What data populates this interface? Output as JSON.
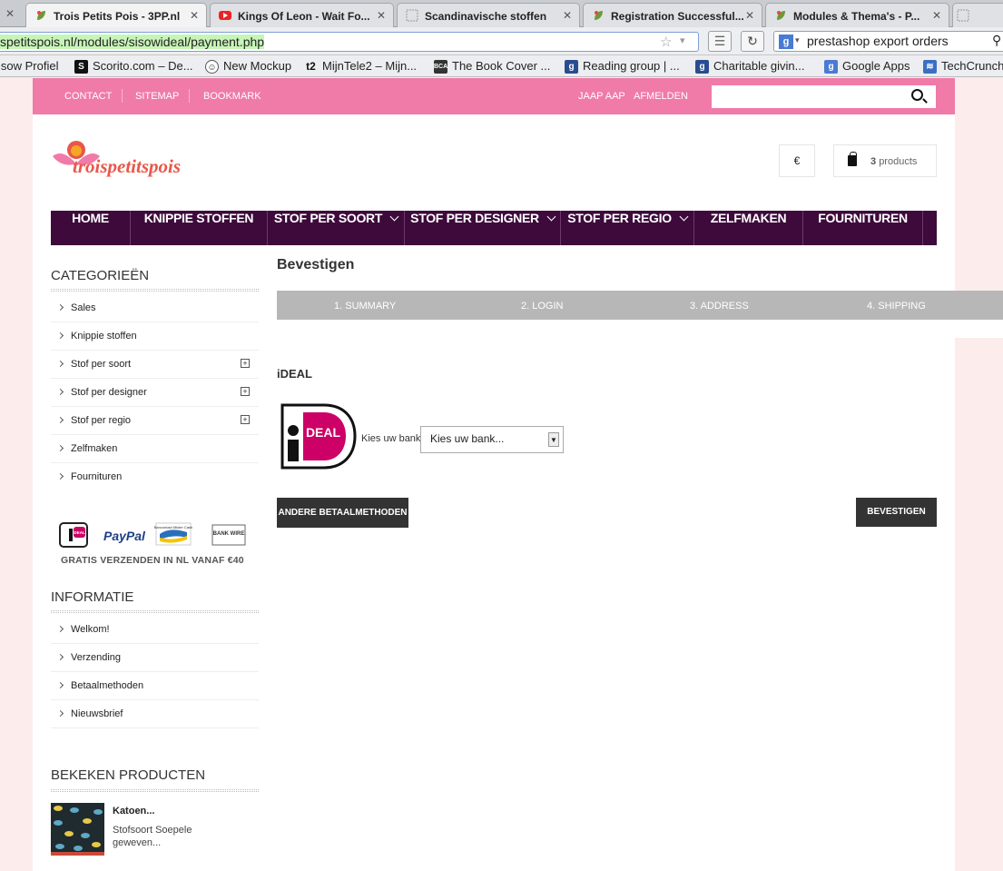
{
  "browser": {
    "tabs": [
      {
        "title": "Trois Petits Pois - 3PP.nl"
      },
      {
        "title": "Kings Of Leon - Wait Fo..."
      },
      {
        "title": "Scandinavische stoffen"
      },
      {
        "title": "Registration Successful..."
      },
      {
        "title": "Modules & Thema's - P..."
      }
    ],
    "url_highlight": "spetitspois.nl/modules/sisowideal/payment.php",
    "search_value": "prestashop export orders",
    "bookmarks": [
      {
        "label": "isow Profiel"
      },
      {
        "label": "Scorito.com – De..."
      },
      {
        "label": "New Mockup"
      },
      {
        "label": "MijnTele2 – Mijn..."
      },
      {
        "label": "The Book Cover ..."
      },
      {
        "label": "Reading group | ..."
      },
      {
        "label": "Charitable givin..."
      },
      {
        "label": "Google Apps"
      },
      {
        "label": "TechCrunch"
      }
    ]
  },
  "topbar": {
    "contact": "CONTACT",
    "sitemap": "SITEMAP",
    "bookmark": "BOOKMARK",
    "user": "JAAP AAP",
    "logout": "AFMELDEN"
  },
  "header": {
    "logo_text": "troispetitspois",
    "currency": "€",
    "cart_count": "3",
    "cart_label": "products"
  },
  "menu": [
    {
      "label": "HOME"
    },
    {
      "label": "KNIPPIE STOFFEN"
    },
    {
      "label": "STOF PER SOORT"
    },
    {
      "label": "STOF PER DESIGNER"
    },
    {
      "label": "STOF PER REGIO"
    },
    {
      "label": "ZELFMAKEN"
    },
    {
      "label": "FOURNITUREN"
    }
  ],
  "sidebar": {
    "categories_title": "CATEGORIEËN",
    "categories": [
      {
        "label": "Sales"
      },
      {
        "label": "Knippie stoffen"
      },
      {
        "label": "Stof per soort"
      },
      {
        "label": "Stof per designer"
      },
      {
        "label": "Stof per regio"
      },
      {
        "label": "Zelfmaken"
      },
      {
        "label": "Fournituren"
      }
    ],
    "payment_methods": [
      "iDEAL",
      "PayPal",
      "Bancontact Mister Cash",
      "BANK WIRE"
    ],
    "free_shipping": "GRATIS VERZENDEN IN NL VANAF €40",
    "info_title": "INFORMATIE",
    "info": [
      {
        "label": "Welkom!"
      },
      {
        "label": "Verzending"
      },
      {
        "label": "Betaalmethoden"
      },
      {
        "label": "Nieuwsbrief"
      }
    ],
    "viewed_title": "BEKEKEN PRODUCTEN",
    "viewed_product": {
      "name": "Katoen...",
      "desc": "Stofsoort Soepele geweven..."
    }
  },
  "main": {
    "title": "Bevestigen",
    "steps": [
      {
        "label": "1. SUMMARY"
      },
      {
        "label": "2. LOGIN"
      },
      {
        "label": "3. ADDRESS"
      },
      {
        "label": "4. SHIPPING"
      }
    ],
    "ideal_title": "iDEAL",
    "ideal_logo_text": "DEAL",
    "bank_label": "Kies uw bank",
    "bank_select": "Kies uw bank...",
    "other_methods": "ANDERE BETAALMETHODEN",
    "confirm": "BEVESTIGEN"
  },
  "colors": {
    "pink": "#f07aa8",
    "menu": "#3d0a3b",
    "ideal": "#cc0066"
  }
}
